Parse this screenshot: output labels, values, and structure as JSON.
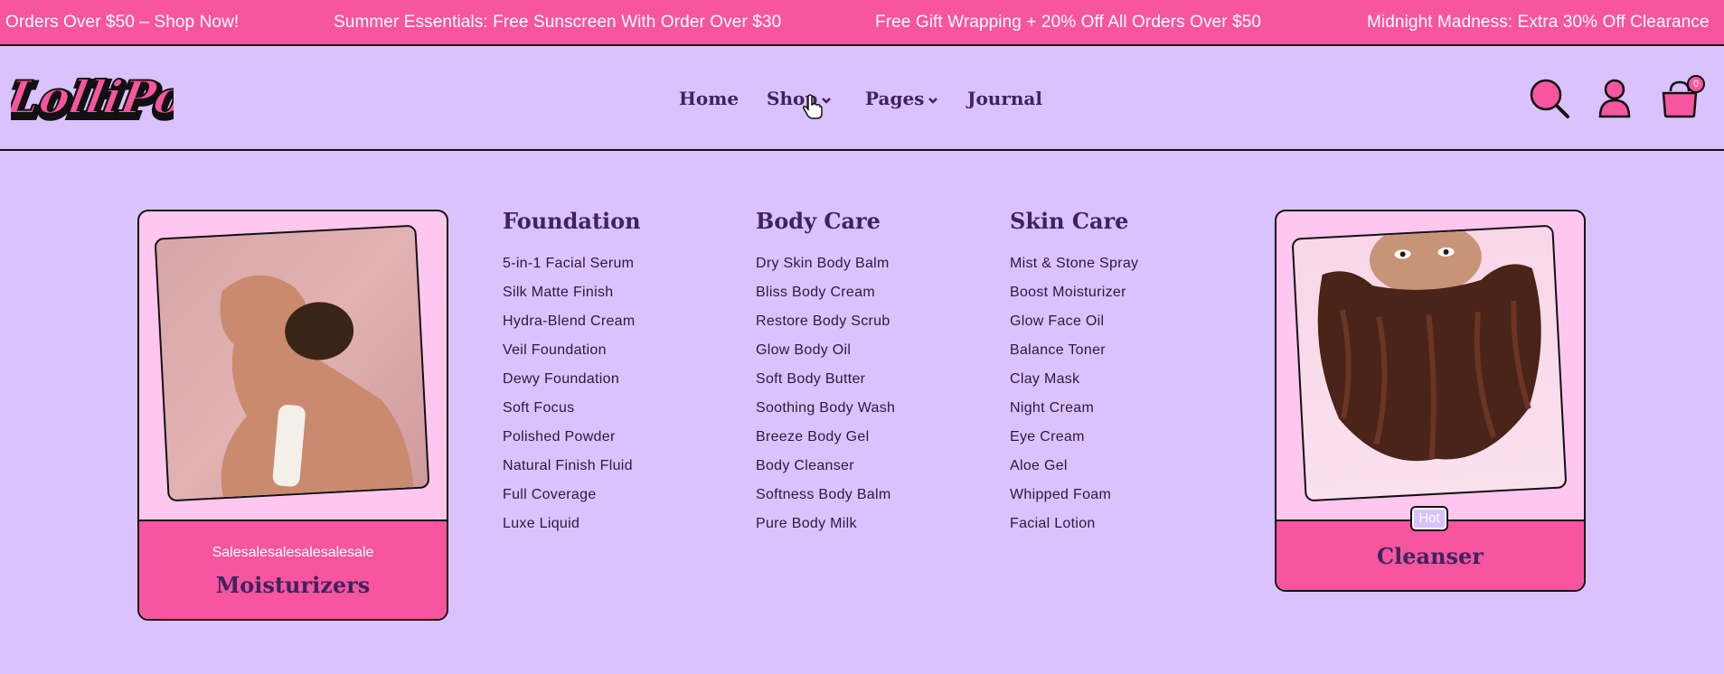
{
  "announcements": [
    "Orders Over $50 – Shop Now!",
    "Summer Essentials: Free Sunscreen With Order Over $30",
    "Free Gift Wrapping + 20% Off All Orders Over $50",
    "Midnight Madness: Extra 30% Off Clearance"
  ],
  "header": {
    "logo_text": "LolliPop",
    "nav": {
      "home": "Home",
      "shop": "Shop",
      "pages": "Pages",
      "journal": "Journal"
    },
    "cart_count": "0",
    "icons": [
      "search-icon",
      "account-icon",
      "cart-icon"
    ]
  },
  "mega_menu": {
    "left_card": {
      "subtitle": "Salesalesalesalesalesale",
      "title": "Moisturizers"
    },
    "right_card": {
      "badge": "Hot",
      "title": "Cleanser"
    },
    "columns": [
      {
        "title": "Foundation",
        "links": [
          "5-in-1 Facial Serum",
          "Silk Matte Finish",
          "Hydra-Blend Cream",
          "Veil Foundation",
          "Dewy Foundation",
          "Soft Focus",
          "Polished Powder",
          "Natural Finish Fluid",
          "Full Coverage",
          "Luxe Liquid"
        ]
      },
      {
        "title": "Body Care",
        "links": [
          "Dry Skin Body Balm",
          "Bliss Body Cream",
          "Restore Body Scrub",
          "Glow Body Oil",
          "Soft Body Butter",
          "Soothing Body Wash",
          "Breeze Body Gel",
          "Body Cleanser",
          "Softness Body Balm",
          "Pure Body Milk"
        ]
      },
      {
        "title": "Skin Care",
        "links": [
          "Mist & Stone Spray",
          "Boost Moisturizer",
          "Glow Face Oil",
          "Balance Toner",
          "Clay Mask",
          "Night Cream",
          "Eye Cream",
          "Aloe Gel",
          "Whipped Foam",
          "Facial Lotion"
        ]
      }
    ]
  },
  "colors": {
    "background": "#dac2fe",
    "accent_pink": "#f8559f",
    "card_pink": "#ffc6ef",
    "text_purple": "#3f2360"
  }
}
